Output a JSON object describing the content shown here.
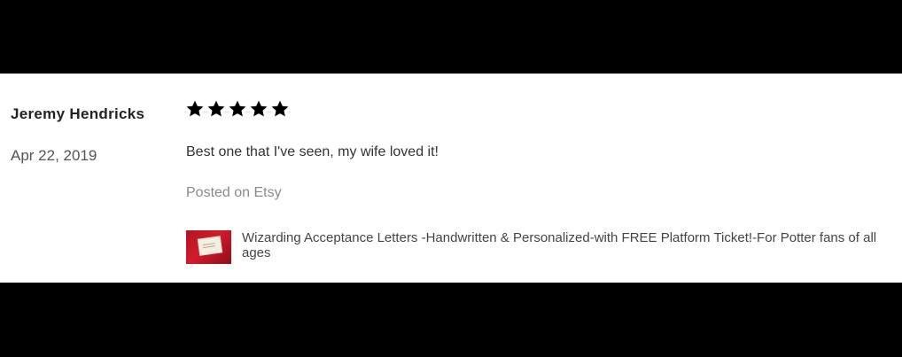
{
  "review": {
    "reviewer_name": "Jeremy Hendricks",
    "date": "Apr 22, 2019",
    "rating": 5,
    "rating_max": 5,
    "text": "Best one that I've seen, my wife loved it!",
    "posted_on": "Posted on Etsy",
    "product": {
      "title": "Wizarding Acceptance Letters -Handwritten & Personalized-with FREE Platform Ticket!-For Potter fans of all ages",
      "thumbnail_icon": "product-photo-icon"
    }
  },
  "colors": {
    "background": "#ffffff",
    "letterbox": "#000000",
    "star": "#000000",
    "name": "#222222",
    "muted": "#8a8a8a",
    "thumb_red": "#c8182a"
  }
}
